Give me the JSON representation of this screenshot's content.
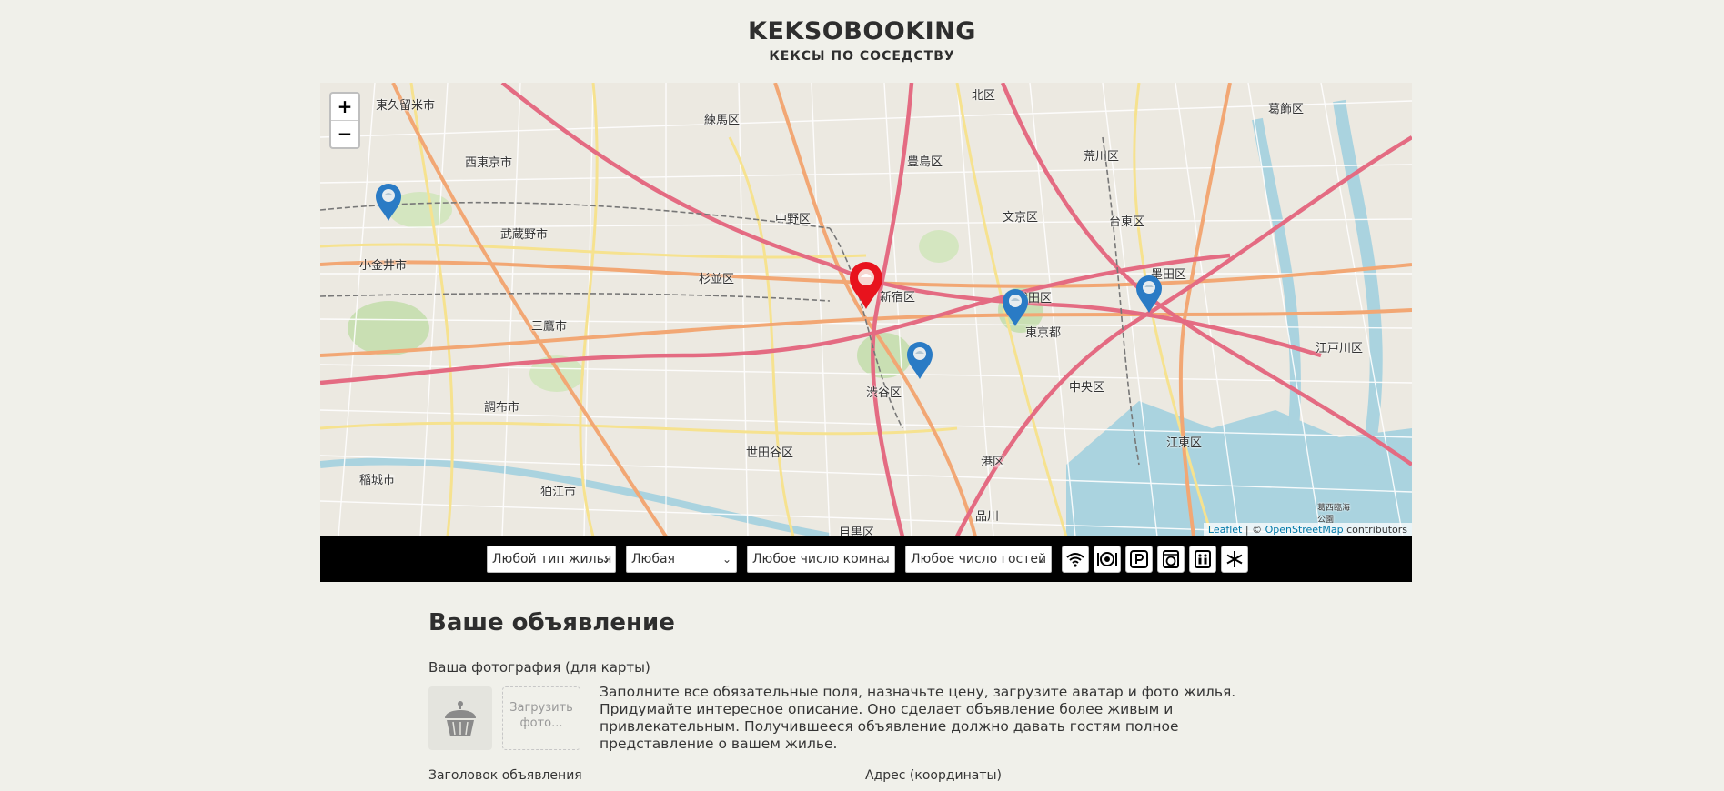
{
  "header": {
    "logo": "KEKSOBOOKING",
    "tagline": "КЕКСЫ ПО СОСЕДСТВУ"
  },
  "map": {
    "zoom_in": "+",
    "zoom_out": "−",
    "attribution": {
      "leaflet": "Leaflet",
      "separator": " | © ",
      "osm": "OpenStreetMap",
      "contributors": " contributors"
    },
    "labels": [
      "東久留米市",
      "西東京市",
      "練馬区",
      "北区",
      "葛飾区",
      "豊島区",
      "荒川区",
      "武蔵野市",
      "中野区",
      "文京区",
      "台東区",
      "小金井市",
      "杉並区",
      "新宿区",
      "墨田区",
      "三鷹市",
      "千代田区",
      "東京都",
      "江戸川区",
      "渋谷区",
      "中央区",
      "調布市",
      "世田谷区",
      "港区",
      "江東区",
      "稲城市",
      "狛江市",
      "目黒区",
      "品川",
      "葛西臨海公園"
    ],
    "colors": {
      "main_pin": "#e8131d",
      "ad_pin": "#2a7bc5"
    }
  },
  "filters": {
    "housing_type": "Любой тип жилья",
    "price": "Любая",
    "rooms": "Любое число комнат",
    "guests": "Любое число гостей",
    "features": [
      "wifi-icon",
      "dishwasher-icon",
      "parking-icon",
      "washer-icon",
      "elevator-icon",
      "conditioner-icon"
    ]
  },
  "form": {
    "title": "Ваше объявление",
    "photo_label": "Ваша фотография (для карты)",
    "upload_label": "Загрузить фото...",
    "notice": "Заполните все обязательные поля, назначьте цену, загрузите аватар и фото жилья. Придумайте интересное описание. Оно сделает объявление более живым и привлекательным. Получившееся объявление должно давать гостям полное представление о вашем жилье.",
    "title_field_label": "Заголовок объявления",
    "address_field_label": "Адрес (координаты)"
  }
}
